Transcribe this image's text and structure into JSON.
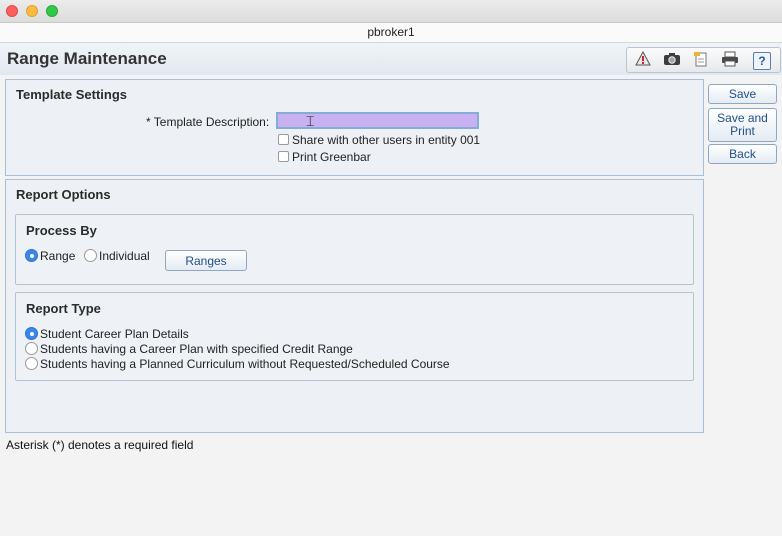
{
  "window": {
    "title": "pbroker1"
  },
  "header": {
    "page_title": "Range Maintenance",
    "toolbar_icons": [
      "alert-icon",
      "camera-icon",
      "notes-icon",
      "printer-icon",
      "help-icon"
    ],
    "help_glyph": "?"
  },
  "actions": {
    "save": "Save",
    "save_and_print": "Save and Print",
    "back": "Back"
  },
  "template_settings": {
    "title": "Template Settings",
    "description_label": "* Template Description:",
    "description_value": "",
    "share_label": "Share with other users in entity 001",
    "share_checked": false,
    "greenbar_label": "Print Greenbar",
    "greenbar_checked": false
  },
  "report_options": {
    "title": "Report Options",
    "process_by": {
      "title": "Process By",
      "options": [
        "Range",
        "Individual"
      ],
      "selected": "Range",
      "ranges_button": "Ranges"
    },
    "report_type": {
      "title": "Report Type",
      "options": [
        "Student Career Plan Details",
        "Students having a Career Plan with specified Credit Range",
        "Students having a Planned Curriculum without Requested/Scheduled Course"
      ],
      "selected": "Student Career Plan Details"
    }
  },
  "footer": {
    "note": "Asterisk (*) denotes a required field"
  },
  "colors": {
    "accent": "#3b86e8",
    "input_highlight": "#c9b0f0",
    "panel_border": "#a9c0d4"
  }
}
